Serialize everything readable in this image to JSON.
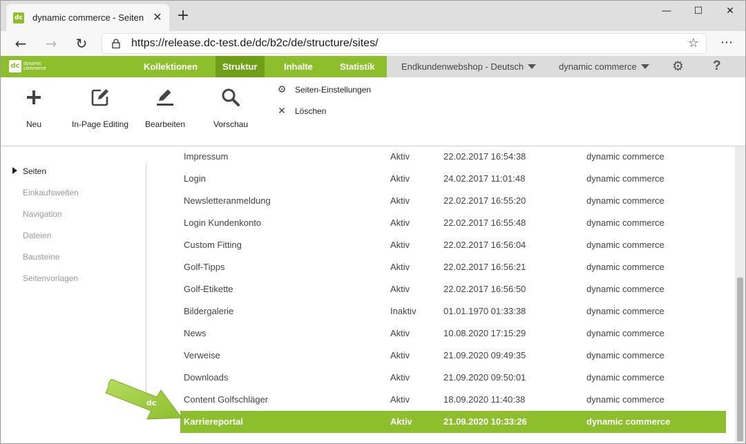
{
  "browser": {
    "tab_title": "dynamic commerce - Seiten",
    "url": "https://release.dc-test.de/dc/b2c/de/structure/sites/",
    "window_controls": {
      "minimize": "—",
      "maximize": "☐",
      "close": "✕"
    }
  },
  "app": {
    "logo": {
      "mark": "dc",
      "line1": "dynamic",
      "line2": "commerce"
    },
    "menu": [
      {
        "label": "Kollektionen",
        "active": false
      },
      {
        "label": "Struktur",
        "active": true
      },
      {
        "label": "Inhalte",
        "active": false
      },
      {
        "label": "Statistik",
        "active": false
      }
    ],
    "shop_selector": "Endkundenwebshop - Deutsch",
    "company_selector": "dynamic commerce",
    "help_label": "?",
    "accent_color": "#8dbf2d"
  },
  "toolbar": {
    "tools": [
      {
        "label": "Neu",
        "icon": "plus-icon"
      },
      {
        "label": "In-Page Editing",
        "icon": "edit-square-icon"
      },
      {
        "label": "Bearbeiten",
        "icon": "pencil-icon"
      },
      {
        "label": "Vorschau",
        "icon": "magnifier-icon"
      }
    ],
    "actions": [
      {
        "label": "Seiten-Einstellungen",
        "icon": "gear-icon"
      },
      {
        "label": "Löschen",
        "icon": "close-icon"
      }
    ]
  },
  "sidebar": {
    "items": [
      {
        "label": "Seiten",
        "active": true
      },
      {
        "label": "Einkaufswelten",
        "active": false
      },
      {
        "label": "Navigation",
        "active": false
      },
      {
        "label": "Dateien",
        "active": false
      },
      {
        "label": "Bausteine",
        "active": false
      },
      {
        "label": "Seitenvorlagen",
        "active": false
      }
    ]
  },
  "table": {
    "rows": [
      {
        "name": "Impressum",
        "status": "Aktiv",
        "date": "22.02.2017 16:54:38",
        "owner": "dynamic commerce"
      },
      {
        "name": "Login",
        "status": "Aktiv",
        "date": "24.02.2017 11:01:48",
        "owner": "dynamic commerce"
      },
      {
        "name": "Newsletteranmeldung",
        "status": "Aktiv",
        "date": "22.02.2017 16:55:20",
        "owner": "dynamic commerce"
      },
      {
        "name": "Login Kundenkonto",
        "status": "Aktiv",
        "date": "22.02.2017 16:55:48",
        "owner": "dynamic commerce"
      },
      {
        "name": "Custom Fitting",
        "status": "Aktiv",
        "date": "22.02.2017 16:56:04",
        "owner": "dynamic commerce"
      },
      {
        "name": "Golf-Tipps",
        "status": "Aktiv",
        "date": "22.02.2017 16:56:21",
        "owner": "dynamic commerce"
      },
      {
        "name": "Golf-Etikette",
        "status": "Aktiv",
        "date": "22.02.2017 16:56:50",
        "owner": "dynamic commerce"
      },
      {
        "name": "Bildergalerie",
        "status": "Inaktiv",
        "date": "01.01.1970 01:33:38",
        "owner": "dynamic commerce"
      },
      {
        "name": "News",
        "status": "Aktiv",
        "date": "10.08.2020 17:15:29",
        "owner": "dynamic commerce"
      },
      {
        "name": "Verweise",
        "status": "Aktiv",
        "date": "21.09.2020 09:49:35",
        "owner": "dynamic commerce"
      },
      {
        "name": "Downloads",
        "status": "Aktiv",
        "date": "21.09.2020 09:50:01",
        "owner": "dynamic commerce"
      },
      {
        "name": "Content Golfschläger",
        "status": "Aktiv",
        "date": "18.09.2020 11:40:38",
        "owner": "dynamic commerce"
      },
      {
        "name": "Karriereportal",
        "status": "Aktiv",
        "date": "21.09.2020 10:33:26",
        "owner": "dynamic commerce",
        "selected": true
      }
    ]
  }
}
